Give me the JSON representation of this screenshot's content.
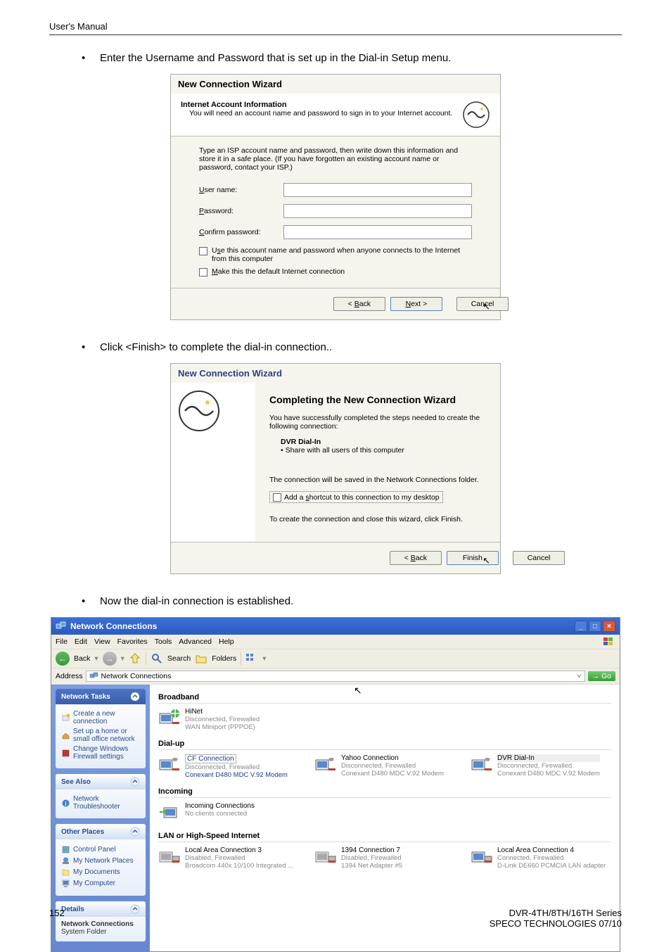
{
  "page": {
    "header": "User's Manual",
    "page_number": "152",
    "footer_right_line1": "DVR-4TH/8TH/16TH Series",
    "footer_right_line2": "SPECO TECHNOLOGIES 07/10"
  },
  "body": {
    "bullet1": "Enter the Username and Password that is set up in the Dial-in Setup menu.",
    "bullet2": "Click <Finish> to complete the dial-in connection..",
    "bullet3": "Now the dial-in connection is established."
  },
  "wizard1": {
    "title": "New Connection Wizard",
    "header_title": "Internet Account Information",
    "header_sub": "You will need an account name and password to sign in to your Internet account.",
    "body_text": "Type an ISP account name and password, then write down this information and store it in a safe place. (If you have forgotten an existing account name or password, contact your ISP.)",
    "label_user": "User name:",
    "label_pass": "Password:",
    "label_confirm": "Confirm password:",
    "check1": "Use this account name and password when anyone connects to the Internet from this computer",
    "check2": "Make this the default Internet connection",
    "btn_back": "< Back",
    "btn_next": "Next >",
    "btn_cancel": "Cancel"
  },
  "wizard2": {
    "title": "New Connection Wizard",
    "main_title": "Completing the New Connection Wizard",
    "text1": "You have successfully completed the steps needed to create the following connection:",
    "conn_name": "DVR Dial-In",
    "conn_share": "Share with all users of this computer",
    "text2": "The connection will be saved in the Network Connections folder.",
    "check_desktop": "Add a shortcut to this connection to my desktop",
    "text3": "To create the connection and close this wizard, click Finish.",
    "btn_back": "< Back",
    "btn_finish": "Finish",
    "btn_cancel": "Cancel"
  },
  "nc": {
    "title": "Network Connections",
    "menu": {
      "file": "File",
      "edit": "Edit",
      "view": "View",
      "favorites": "Favorites",
      "tools": "Tools",
      "advanced": "Advanced",
      "help": "Help"
    },
    "toolbar": {
      "back": "Back",
      "search": "Search",
      "folders": "Folders"
    },
    "address": {
      "label": "Address",
      "value": "Network Connections",
      "go": "Go"
    },
    "sidebar": {
      "panel1_title": "Network Tasks",
      "panel1_items": [
        "Create a new connection",
        "Set up a home or small office network",
        "Change Windows Firewall settings"
      ],
      "panel2_title": "See Also",
      "panel2_items": [
        "Network Troubleshooter"
      ],
      "panel3_title": "Other Places",
      "panel3_items": [
        "Control Panel",
        "My Network Places",
        "My Documents",
        "My Computer"
      ],
      "panel4_title": "Details",
      "panel4_line1": "Network Connections",
      "panel4_line2": "System Folder"
    },
    "groups": {
      "broadband": "Broadband",
      "dialup": "Dial-up",
      "incoming": "Incoming",
      "lan": "LAN or High-Speed Internet"
    },
    "items": {
      "hinet": {
        "name": "HiNet",
        "status": "Disconnected, Firewalled",
        "dev": "WAN Miniport (PPPOE)"
      },
      "cf": {
        "name": "CF Connection",
        "status": "Disconnected, Firewalled",
        "dev": "Conexant D480 MDC V.92 Modem"
      },
      "yahoo": {
        "name": "Yahoo Connection",
        "status": "Disconnected, Firewalled",
        "dev": "Conexant D480 MDC V.92 Modem"
      },
      "dvr": {
        "name": "DVR Dial-In",
        "status": "Disconnected, Firewalled",
        "dev": "Conexant D480 MDC V.92 Modem"
      },
      "incoming": {
        "name": "Incoming Connections",
        "status": "No clients connected"
      },
      "lac3": {
        "name": "Local Area Connection 3",
        "status": "Disabled, Firewalled",
        "dev": "Broadcom 440x 10/100 Integrated ..."
      },
      "c1394": {
        "name": "1394 Connection 7",
        "status": "Disabled, Firewalled",
        "dev": "1394 Net Adapter #5"
      },
      "lac4": {
        "name": "Local Area Connection 4",
        "status": "Connected, Firewalled",
        "dev": "D-Link DE660 PCMCIA LAN adapter"
      }
    }
  }
}
